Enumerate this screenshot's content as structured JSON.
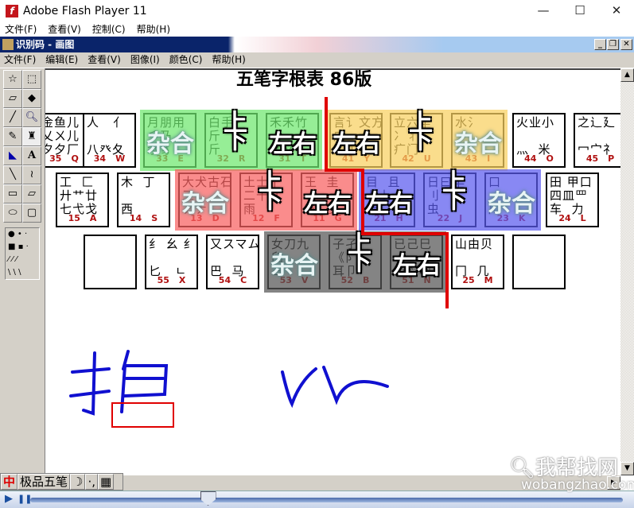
{
  "flash": {
    "title": "Adobe Flash Player 11",
    "menu": [
      "文件(F)",
      "查看(V)",
      "控制(C)",
      "帮助(H)"
    ],
    "controls": {
      "minimize": "—",
      "maximize": "☐",
      "close": "✕"
    }
  },
  "paint": {
    "title": "识别码 - 画图",
    "menu": [
      "文件(F)",
      "编辑(E)",
      "查看(V)",
      "图像(I)",
      "颜色(C)",
      "帮助(H)"
    ]
  },
  "canvas": {
    "heading": "五笔字根表 86版",
    "rows": [
      [
        {
          "roots": "金鱼儿\n乂ㄨ儿\n夕夕厂",
          "num": "35",
          "letter": "Q"
        },
        {
          "roots": "人   亻\n\n八癶夂",
          "num": "34",
          "letter": "W"
        },
        {
          "roots": "月朋用\n彡乃\n豕豸",
          "num": "33",
          "letter": "E",
          "group": "green"
        },
        {
          "roots": "白手扌\n斤  ⺮\n斤",
          "num": "32",
          "letter": "R",
          "group": "green"
        },
        {
          "roots": "禾禾竹\n丿\n攵夂",
          "num": "31",
          "letter": "T",
          "group": "green"
        },
        {
          "roots": "言讠文方\n广\n广主",
          "num": "41",
          "letter": "Y",
          "group": "yellow"
        },
        {
          "roots": "立六辛\n冫丬\n疒门",
          "num": "42",
          "letter": "U",
          "group": "yellow"
        },
        {
          "roots": "水氵\n\n小",
          "num": "43",
          "letter": "I",
          "group": "yellow"
        },
        {
          "roots": "火业小\n\n灬  米",
          "num": "44",
          "letter": "O"
        },
        {
          "roots": "之辶廴\n\n冖宀礻",
          "num": "45",
          "letter": "P"
        }
      ],
      [
        {
          "roots": "工  匚\n廾艹廿\n七弋戈",
          "num": "15",
          "letter": "A"
        },
        {
          "roots": "木  丁\n\n西",
          "num": "14",
          "letter": "S"
        },
        {
          "roots": "大犬古石\n三\nアナ",
          "num": "13",
          "letter": "D",
          "group": "red"
        },
        {
          "roots": "土士干\n二十寸\n雨",
          "num": "12",
          "letter": "F",
          "group": "red"
        },
        {
          "roots": "王  圭\n一\n五  戋",
          "num": "11",
          "letter": "G",
          "group": "red"
        },
        {
          "roots": "目  且\n卜上\n止",
          "num": "21",
          "letter": "H",
          "group": "blue"
        },
        {
          "roots": "日曰早\n刂\n虫",
          "num": "22",
          "letter": "J",
          "group": "blue"
        },
        {
          "roots": "口\n\n川",
          "num": "23",
          "letter": "K",
          "group": "blue"
        },
        {
          "roots": "田 甲口\n四皿罒\n车  力",
          "num": "24",
          "letter": "L"
        }
      ],
      [
        {
          "roots": "",
          "num": "",
          "letter": ""
        },
        {
          "roots": "纟 幺 纟\n\n匕   ㄴ",
          "num": "55",
          "letter": "X"
        },
        {
          "roots": "又スマム\n\n巴  马",
          "num": "54",
          "letter": "C"
        },
        {
          "roots": "女刀九\n臼\nヨ",
          "num": "53",
          "letter": "V",
          "group": "gray"
        },
        {
          "roots": "子孑\n《阝\n耳卩",
          "num": "52",
          "letter": "B",
          "group": "gray"
        },
        {
          "roots": "已己巳\n\n心忄羽",
          "num": "51",
          "letter": "N",
          "group": "gray"
        },
        {
          "roots": "山由贝\n\n冂  几",
          "num": "25",
          "letter": "M"
        },
        {
          "roots": "",
          "num": "",
          "letter": ""
        }
      ]
    ],
    "overlays": {
      "mixed": "杂合",
      "topbottom": "上下",
      "leftright": "左右"
    },
    "group_colors": {
      "green": "#6ee86e",
      "yellow": "#f8d060",
      "red": "#f86060",
      "blue": "#5a5aee",
      "gray": "#555555"
    },
    "annotation_color": "#e00000",
    "ink_color": "#1010d0"
  },
  "ime": {
    "logo": "中",
    "name": "极品五笔",
    "moon": "☽",
    "punct": "·,",
    "keyboard": "▦"
  },
  "player": {
    "play": "▶",
    "pause": "❚❚",
    "progress": 0.3
  },
  "watermark": {
    "cn": "我帮找网",
    "en": "wobangzhao.com"
  }
}
